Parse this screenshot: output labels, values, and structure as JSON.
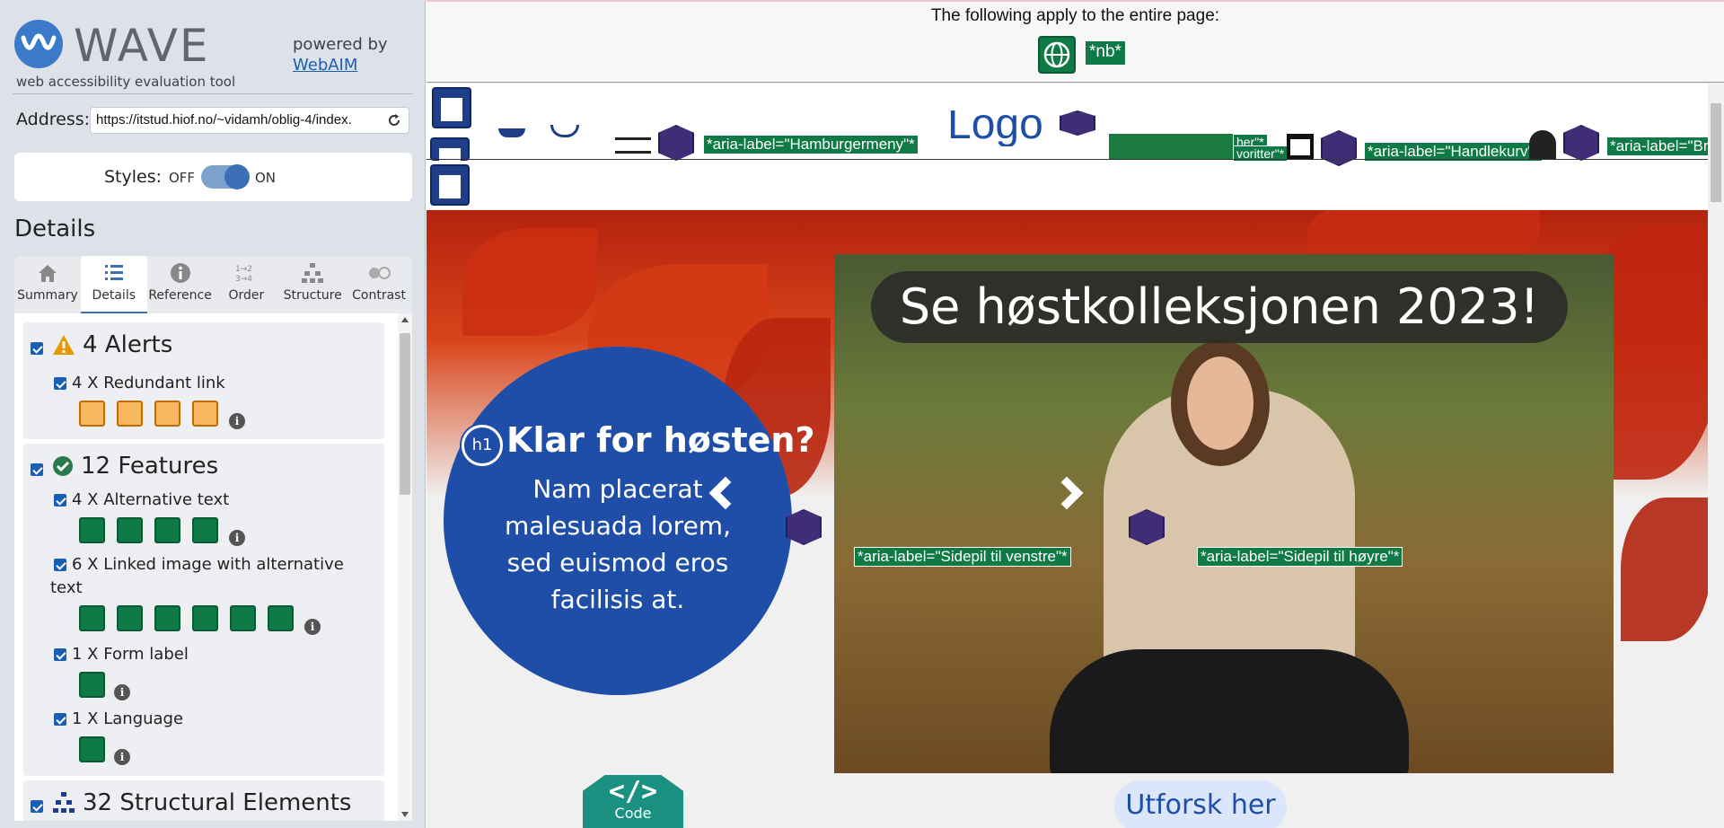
{
  "sidebar": {
    "logo_text": "WAVE",
    "tagline": "web accessibility evaluation tool",
    "powered_by": "powered by",
    "webaim_link": "WebAIM",
    "address_label": "Address:",
    "address_value": "https://itstud.hiof.no/~vidamh/oblig-4/index.",
    "styles_label": "Styles:",
    "styles_off": "OFF",
    "styles_on": "ON",
    "details_heading": "Details",
    "tabs": [
      {
        "label": "Summary",
        "icon": "home-icon"
      },
      {
        "label": "Details",
        "icon": "list-icon"
      },
      {
        "label": "Reference",
        "icon": "info-icon"
      },
      {
        "label": "Order",
        "icon": "order-icon"
      },
      {
        "label": "Structure",
        "icon": "structure-icon"
      },
      {
        "label": "Contrast",
        "icon": "contrast-icon"
      }
    ],
    "active_tab": "Details",
    "groups": {
      "alerts": {
        "title": "4 Alerts",
        "items": [
          {
            "label": "4 X Redundant link",
            "count": 4
          }
        ]
      },
      "features": {
        "title": "12 Features",
        "items": [
          {
            "label": "4 X Alternative text",
            "count": 4
          },
          {
            "label_line1": "6 X Linked image with alternative",
            "label_line2": "text",
            "count": 6
          },
          {
            "label": "1 X Form label",
            "count": 1
          },
          {
            "label": "1 X Language",
            "count": 1
          }
        ]
      },
      "structural": {
        "title": "32 Structural Elements"
      }
    },
    "info_glyph": "i"
  },
  "main": {
    "entire_page_text": "The following apply to the entire page:",
    "nb_tag": "*nb*",
    "header": {
      "aria_hamburger": "*aria-label=\"Hamburgermeny\"*",
      "logo_word": "Logo",
      "aria_favoritter_a": "her\"*",
      "aria_favoritter_b": "voritter\"*",
      "aria_handlekurv": "*aria-label=\"Handlekurv\"*",
      "aria_bruker": "*aria-label=\"Br"
    },
    "hero": {
      "title": "Se høstkolleksjonen 2023!",
      "h1_badge": "h1",
      "circle_title": "Klar for høsten?",
      "circle_body": "Nam placerat malesuada lorem, sed euismod eros facilisis at.",
      "aria_left": "*aria-label=\"Sidepil til venstre\"*",
      "aria_right": "*aria-label=\"Sidepil til høyre\"*",
      "cta": "Utforsk her"
    },
    "code_button": {
      "symbol": "</>",
      "label": "Code"
    }
  },
  "colors": {
    "feature_green": "#0f7a45",
    "alert_orange": "#f7b860",
    "structure_blue": "#1f3e8a",
    "aria_purple": "#3f2e77",
    "brand_blue": "#1e4ea8"
  }
}
